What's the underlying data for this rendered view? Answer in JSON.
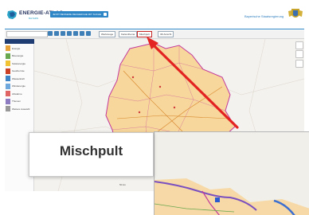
{
  "brand": {
    "name": "ENERGIE-ATLAS",
    "sub": "BAYERN"
  },
  "promo_banner": {
    "label": "JETZT BESSERE RECHERCHE MIT SUCHE"
  },
  "government_label": "Bayerische Staatsregierung",
  "toolbar": {
    "search_placeholder": "",
    "buttons": [
      "Werkzeuge",
      "Kartenthema",
      "Mischpult",
      "3D Ansicht"
    ],
    "active_button": "Mischpult"
  },
  "sidebar": {
    "items": [
      {
        "label": "Energie",
        "color": "#e7a33a"
      },
      {
        "label": "Bioenergie",
        "color": "#6aa84f"
      },
      {
        "label": "Solarenergie",
        "color": "#f1c232"
      },
      {
        "label": "Geothermie",
        "color": "#cc4125"
      },
      {
        "label": "Wasserkraft",
        "color": "#3d85c6"
      },
      {
        "label": "Windenergie",
        "color": "#6fa8dc"
      },
      {
        "label": "Abwärme",
        "color": "#e06666"
      },
      {
        "label": "Themen",
        "color": "#8e7cc3"
      },
      {
        "label": "Weitere Auswahl",
        "color": "#999999"
      }
    ]
  },
  "map": {
    "region_color": "#f7d79b",
    "border_color": "#c33a9b",
    "scale_label": "50 km",
    "button_label": "Drucken"
  },
  "zoom_callout": {
    "label": "Mischpult",
    "arrow_color": "#e32222"
  }
}
